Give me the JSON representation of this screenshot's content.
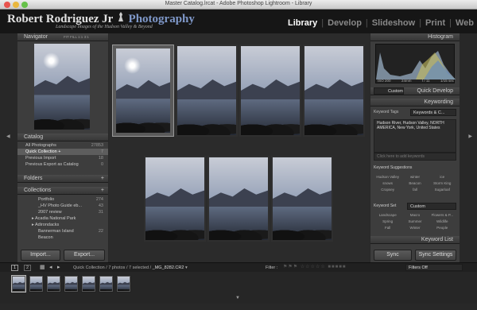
{
  "window": {
    "title": "Master Catalog.lrcat - Adobe Photoshop Lightroom - Library"
  },
  "identity": {
    "name_first": "Robert Rodriguez Jr",
    "name_second": "Photography",
    "tagline": "Landscape Images of the Hudson Valley & Beyond"
  },
  "modules": [
    "Library",
    "Develop",
    "Slideshow",
    "Print",
    "Web"
  ],
  "navigator": {
    "title": "Navigator",
    "zoom": [
      "FIT",
      "FILL",
      "1:1",
      "3:1"
    ]
  },
  "catalog": {
    "title": "Catalog",
    "items": [
      {
        "label": "All Photographs",
        "count": "27853"
      },
      {
        "label": "Quick Collection +",
        "count": "7"
      },
      {
        "label": "Previous Import",
        "count": "18"
      },
      {
        "label": "Previous Export as Catalog",
        "count": "0"
      }
    ]
  },
  "folders": {
    "title": "Folders"
  },
  "collections": {
    "title": "Collections",
    "items": [
      {
        "label": "Portfolio",
        "count": "274"
      },
      {
        "label": "_HV Photo Guide eb...",
        "count": "43"
      },
      {
        "label": "2007 review",
        "count": "31"
      },
      {
        "label": "Acadia National Park",
        "count": ""
      },
      {
        "label": "Adirondacks",
        "count": ""
      },
      {
        "label": "Bannerman Island",
        "count": "22"
      },
      {
        "label": "Beacon",
        "count": ""
      }
    ]
  },
  "left_buttons": {
    "import": "Import...",
    "export": "Export..."
  },
  "histogram": {
    "title": "Histogram",
    "info": [
      "ISO 200",
      "24mm",
      "f / 11",
      "1/15 sec"
    ]
  },
  "quick_develop": {
    "preset": "Custom",
    "title": "Quick Develop"
  },
  "keywording": {
    "title": "Keywording",
    "tags_label": "Keyword Tags",
    "tags_mode": "Keywords & C...",
    "keywords": "Hudson River, Hudson Valley, NORTH AMERICA, New York, United States",
    "placeholder": "Click here to add keywords"
  },
  "keyword_suggestions": {
    "title": "Keyword Suggestions",
    "items": [
      "Hudson Valley",
      "winter",
      "ice",
      "snows",
      "Beacon",
      "Storm King",
      "Cropsey",
      "fall",
      "Sugarloaf"
    ]
  },
  "keyword_set": {
    "label": "Keyword Set",
    "value": "Custom",
    "items": [
      "Landscape",
      "Macro",
      "Flowers & P...",
      "Spring",
      "Summer",
      "Wildlife",
      "Fall",
      "Winter",
      "People"
    ]
  },
  "keyword_list": {
    "title": "Keyword List"
  },
  "right_buttons": {
    "sync": "Sync",
    "sync_settings": "Sync Settings"
  },
  "filmstrip": {
    "pages": [
      "1",
      "2"
    ],
    "path": "Quick Collection / 7 photos / 7 selected /",
    "filename": "_MG_8282.CR2",
    "filter_label": "Filter :",
    "filter_value": "Filters Off"
  }
}
